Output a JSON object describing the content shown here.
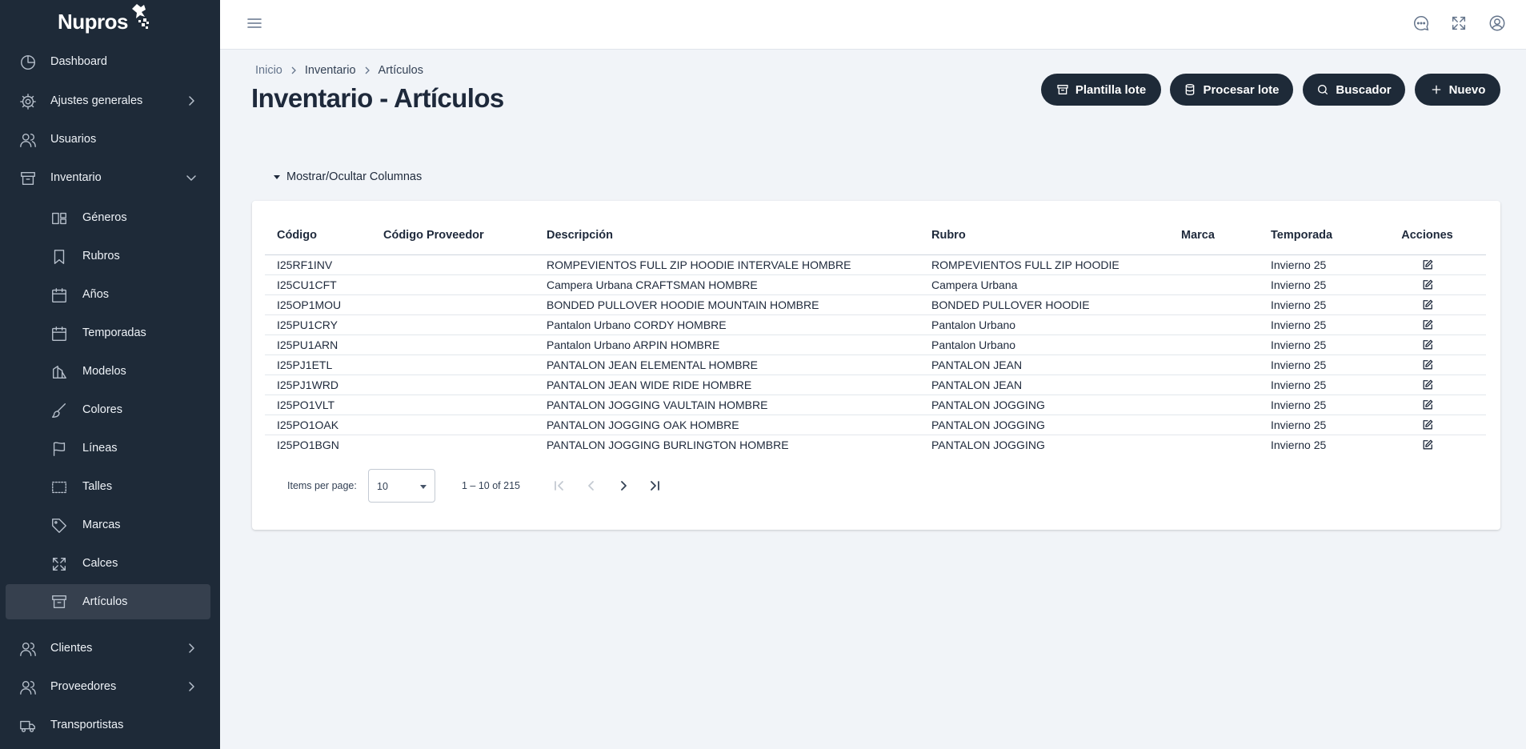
{
  "app": {
    "logo_text": "Nupros"
  },
  "sidebar": {
    "items": [
      {
        "label": "Dashboard",
        "icon": "pie-chart-icon"
      },
      {
        "label": "Ajustes generales",
        "icon": "gear-icon"
      },
      {
        "label": "Usuarios",
        "icon": "users-icon"
      },
      {
        "label": "Inventario",
        "icon": "archive-icon"
      },
      {
        "label": "Géneros",
        "icon": "layout-icon"
      },
      {
        "label": "Rubros",
        "icon": "bookmark-icon"
      },
      {
        "label": "Años",
        "icon": "calendar-icon"
      },
      {
        "label": "Temporadas",
        "icon": "calendar-icon"
      },
      {
        "label": "Modelos",
        "icon": "shapes-icon"
      },
      {
        "label": "Colores",
        "icon": "brush-icon"
      },
      {
        "label": "Líneas",
        "icon": "flag-icon"
      },
      {
        "label": "Talles",
        "icon": "ruler-icon"
      },
      {
        "label": "Marcas",
        "icon": "tag-icon"
      },
      {
        "label": "Calces",
        "icon": "expand-icon"
      },
      {
        "label": "Artículos",
        "icon": "archive-icon"
      },
      {
        "label": "Clientes",
        "icon": "users-icon"
      },
      {
        "label": "Proveedores",
        "icon": "users-icon"
      },
      {
        "label": "Transportistas",
        "icon": "truck-icon"
      }
    ]
  },
  "topbar": {
    "icons": [
      "menu-icon",
      "chat-icon",
      "fullscreen-icon",
      "user-circle-icon"
    ]
  },
  "breadcrumb": {
    "home": "Inicio",
    "section": "Inventario",
    "current": "Artículos"
  },
  "page": {
    "title": "Inventario - Artículos"
  },
  "actions": {
    "template_label": "Plantilla lote",
    "process_label": "Procesar lote",
    "search_label": "Buscador",
    "new_label": "Nuevo"
  },
  "columns_toggle": {
    "label": "Mostrar/Ocultar Columnas"
  },
  "table": {
    "headers": [
      "Código",
      "Código Proveedor",
      "Descripción",
      "Rubro",
      "Marca",
      "Temporada",
      "Acciones"
    ],
    "rows": [
      [
        "I25RF1INV",
        "",
        "ROMPEVIENTOS FULL ZIP HOODIE INTERVALE HOMBRE",
        "ROMPEVIENTOS FULL ZIP HOODIE",
        "",
        "Invierno 25"
      ],
      [
        "I25CU1CFT",
        "",
        "Campera Urbana CRAFTSMAN HOMBRE",
        "Campera Urbana",
        "",
        "Invierno 25"
      ],
      [
        "I25OP1MOU",
        "",
        "BONDED PULLOVER HOODIE MOUNTAIN HOMBRE",
        "BONDED PULLOVER HOODIE",
        "",
        "Invierno 25"
      ],
      [
        "I25PU1CRY",
        "",
        "Pantalon Urbano CORDY HOMBRE",
        "Pantalon Urbano",
        "",
        "Invierno 25"
      ],
      [
        "I25PU1ARN",
        "",
        "Pantalon Urbano ARPIN HOMBRE",
        "Pantalon Urbano",
        "",
        "Invierno 25"
      ],
      [
        "I25PJ1ETL",
        "",
        "PANTALON JEAN ELEMENTAL HOMBRE",
        "PANTALON JEAN",
        "",
        "Invierno 25"
      ],
      [
        "I25PJ1WRD",
        "",
        "PANTALON JEAN WIDE RIDE HOMBRE",
        "PANTALON JEAN",
        "",
        "Invierno 25"
      ],
      [
        "I25PO1VLT",
        "",
        "PANTALON JOGGING VAULTAIN HOMBRE",
        "PANTALON JOGGING",
        "",
        "Invierno 25"
      ],
      [
        "I25PO1OAK",
        "",
        "PANTALON JOGGING OAK HOMBRE",
        "PANTALON JOGGING",
        "",
        "Invierno 25"
      ],
      [
        "I25PO1BGN",
        "",
        "PANTALON JOGGING BURLINGTON HOMBRE",
        "PANTALON JOGGING",
        "",
        "Invierno 25"
      ]
    ]
  },
  "paginator": {
    "items_per_page_label": "Items per page:",
    "page_size": "10",
    "range_label": "1 – 10 of 215"
  },
  "colors": {
    "sidebar_bg": "#1e2a38",
    "accent_button": "#1e2a38",
    "page_bg": "#f1f4f8"
  }
}
